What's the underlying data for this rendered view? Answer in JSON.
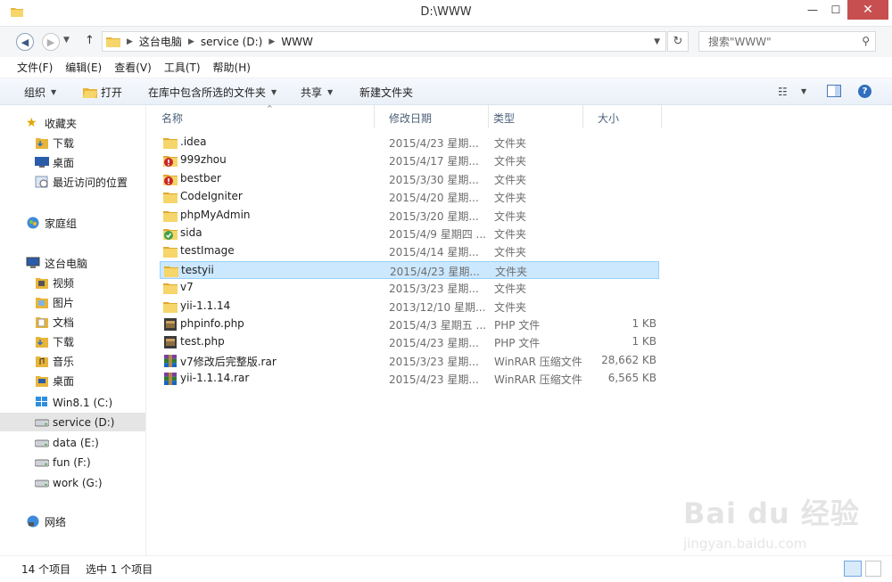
{
  "window": {
    "title": "D:\\WWW",
    "min_glyph": "—",
    "max_glyph": "☐",
    "close_glyph": "✕"
  },
  "address": {
    "crumbs": [
      "这台电脑",
      "service (D:)",
      "WWW"
    ],
    "search_placeholder": "搜索\"WWW\""
  },
  "menu": [
    "文件(F)",
    "编辑(E)",
    "查看(V)",
    "工具(T)",
    "帮助(H)"
  ],
  "commands": {
    "organize": "组织",
    "open": "打开",
    "include": "在库中包含所选的文件夹",
    "share": "共享",
    "new_folder": "新建文件夹"
  },
  "nav": {
    "favorites_label": "收藏夹",
    "favorites": [
      "下载",
      "桌面",
      "最近访问的位置"
    ],
    "homegroup": "家庭组",
    "computer_label": "这台电脑",
    "computer": [
      "视频",
      "图片",
      "文档",
      "下载",
      "音乐",
      "桌面",
      "Win8.1 (C:)",
      "service (D:)",
      "data (E:)",
      "fun (F:)",
      "work (G:)"
    ],
    "network": "网络"
  },
  "columns": [
    "名称",
    "修改日期",
    "类型",
    "大小"
  ],
  "files": [
    {
      "name": ".idea",
      "date": "2015/4/23 星期...",
      "type": "文件夹",
      "size": "",
      "icon": "folder-icon"
    },
    {
      "name": "999zhou",
      "date": "2015/4/17 星期...",
      "type": "文件夹",
      "size": "",
      "icon": "folder-conflict-icon"
    },
    {
      "name": "bestber",
      "date": "2015/3/30 星期...",
      "type": "文件夹",
      "size": "",
      "icon": "folder-conflict-icon"
    },
    {
      "name": "CodeIgniter",
      "date": "2015/4/20 星期...",
      "type": "文件夹",
      "size": "",
      "icon": "folder-icon"
    },
    {
      "name": "phpMyAdmin",
      "date": "2015/3/20 星期...",
      "type": "文件夹",
      "size": "",
      "icon": "folder-icon"
    },
    {
      "name": "sida",
      "date": "2015/4/9 星期四 ...",
      "type": "文件夹",
      "size": "",
      "icon": "folder-synced-icon"
    },
    {
      "name": "testImage",
      "date": "2015/4/14 星期...",
      "type": "文件夹",
      "size": "",
      "icon": "folder-icon"
    },
    {
      "name": "testyii",
      "date": "2015/4/23 星期...",
      "type": "文件夹",
      "size": "",
      "icon": "folder-icon"
    },
    {
      "name": "v7",
      "date": "2015/3/23 星期...",
      "type": "文件夹",
      "size": "",
      "icon": "folder-icon"
    },
    {
      "name": "yii-1.1.14",
      "date": "2013/12/10 星期...",
      "type": "文件夹",
      "size": "",
      "icon": "folder-icon"
    },
    {
      "name": "phpinfo.php",
      "date": "2015/4/3 星期五 ...",
      "type": "PHP 文件",
      "size": "1 KB",
      "icon": "php-file-icon"
    },
    {
      "name": "test.php",
      "date": "2015/4/23 星期...",
      "type": "PHP 文件",
      "size": "1 KB",
      "icon": "php-file-icon"
    },
    {
      "name": "v7修改后完整版.rar",
      "date": "2015/3/23 星期...",
      "type": "WinRAR 压缩文件",
      "size": "28,662 KB",
      "icon": "rar-archive-icon"
    },
    {
      "name": "yii-1.1.14.rar",
      "date": "2015/4/23 星期...",
      "type": "WinRAR 压缩文件",
      "size": "6,565 KB",
      "icon": "rar-archive-icon"
    }
  ],
  "status": {
    "count": "14 个项目",
    "selected": "选中 1 个项目"
  },
  "watermark": {
    "text": "Bai du 经验",
    "url": "jingyan.baidu.com"
  }
}
